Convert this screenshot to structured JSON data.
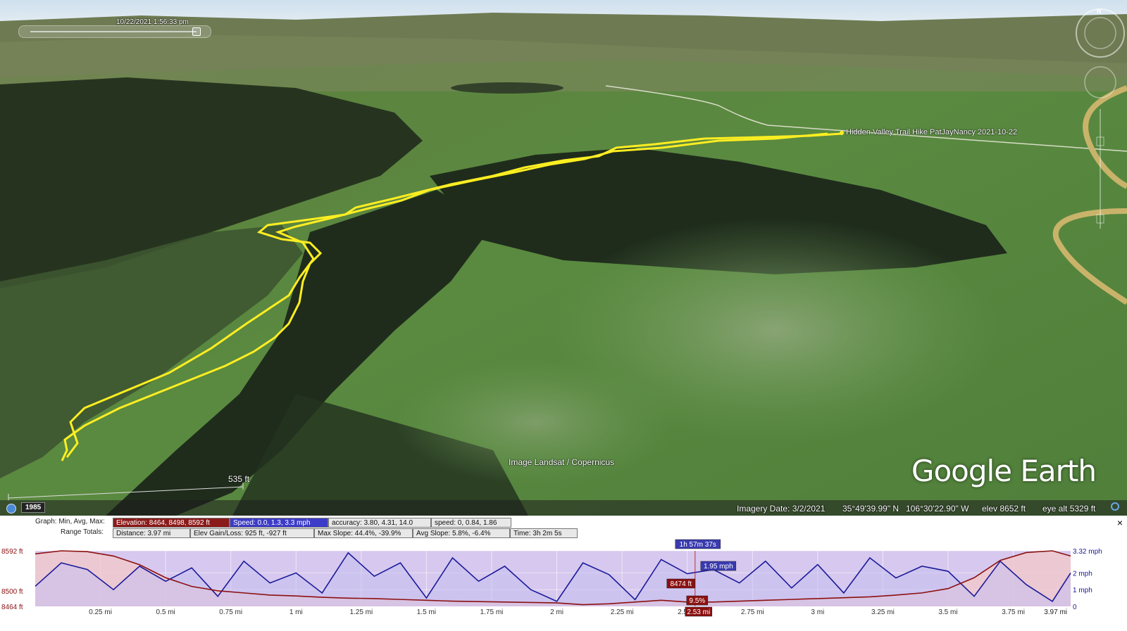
{
  "viewport": {
    "timestamp": "10/22/2021   1:56:33 pm",
    "placemark_label": "Hidden Valley Trail Hike PatJayNancy 2021-10-22",
    "image_credit": "Image Landsat / Copernicus",
    "scale_label": "535 ft",
    "logo": "Google Earth",
    "compass_label": "N",
    "track_color": "#ffee22"
  },
  "status_bar": {
    "year": "1985",
    "imagery_date": "Imagery Date: 3/2/2021",
    "latitude": "35°49'39.99\" N",
    "longitude": "106°30'22.90\" W",
    "elevation": "elev  8652 ft",
    "eye_alt": "eye alt    5329 ft"
  },
  "profile": {
    "graph_label": "Graph: Min, Avg, Max:",
    "range_label": "Range Totals:",
    "graph_stats": [
      {
        "text": "Elevation: 8464, 8498, 8592 ft",
        "kind": "elev"
      },
      {
        "text": "Speed: 0.0, 1.3, 3.3 mph",
        "kind": "speed"
      },
      {
        "text": "accuracy: 3.80, 4.31, 14.0",
        "kind": "plain"
      },
      {
        "text": "speed: 0, 0.84, 1.86",
        "kind": "plain"
      }
    ],
    "range_totals": [
      "Distance: 3.97 mi",
      "Elev Gain/Loss: 925 ft, -927 ft",
      "Max Slope: 44.4%, -39.9%",
      "Avg Slope: 5.8%, -6.4%",
      "Time: 3h 2m 5s"
    ],
    "close": "×"
  },
  "chart_data": {
    "type": "line",
    "x": [
      0,
      0.1,
      0.2,
      0.3,
      0.4,
      0.5,
      0.6,
      0.7,
      0.8,
      0.9,
      1,
      1.1,
      1.2,
      1.3,
      1.4,
      1.5,
      1.6,
      1.7,
      1.8,
      1.9,
      2,
      2.1,
      2.2,
      2.3,
      2.4,
      2.5,
      2.6,
      2.7,
      2.8,
      2.9,
      3,
      3.1,
      3.2,
      3.3,
      3.4,
      3.5,
      3.6,
      3.7,
      3.8,
      3.9,
      3.97
    ],
    "series": [
      {
        "name": "Elevation",
        "axis": "left",
        "color": "#8b1010",
        "values": [
          8585,
          8592,
          8590,
          8580,
          8560,
          8530,
          8510,
          8500,
          8495,
          8490,
          8488,
          8485,
          8483,
          8482,
          8480,
          8478,
          8476,
          8475,
          8474,
          8473,
          8472,
          8468,
          8470,
          8474,
          8478,
          8474,
          8474,
          8476,
          8478,
          8480,
          8482,
          8484,
          8486,
          8490,
          8495,
          8505,
          8530,
          8570,
          8588,
          8592,
          8580
        ]
      },
      {
        "name": "Speed",
        "axis": "right",
        "color": "#1a1a9a",
        "values": [
          1.2,
          2.6,
          2.2,
          1.0,
          2.4,
          1.5,
          2.3,
          0.6,
          2.7,
          1.4,
          2.0,
          0.8,
          3.2,
          1.8,
          2.6,
          0.5,
          2.9,
          1.5,
          2.4,
          1.0,
          0.3,
          2.6,
          1.9,
          0.4,
          2.8,
          1.95,
          2.2,
          1.4,
          2.7,
          1.1,
          2.5,
          0.8,
          2.9,
          1.7,
          2.4,
          2.1,
          0.6,
          2.7,
          1.3,
          0.3,
          2.0
        ]
      }
    ],
    "x_tick_labels": [
      "0.25 mi",
      "0.5 mi",
      "0.75 mi",
      "1 mi",
      "1.25 mi",
      "1.5 mi",
      "1.75 mi",
      "2 mi",
      "2.25 mi",
      "2.5 mi",
      "2.75 mi",
      "3 mi",
      "3.25 mi",
      "3.5 mi",
      "3.75 mi"
    ],
    "x_tick_values": [
      0.25,
      0.5,
      0.75,
      1,
      1.25,
      1.5,
      1.75,
      2,
      2.25,
      2.5,
      2.75,
      3,
      3.25,
      3.5,
      3.75
    ],
    "x_end_label": "3.97 mi",
    "y_left_labels": [
      "8592 ft",
      "8500 ft",
      "8464 ft"
    ],
    "y_left_values": [
      8592,
      8500,
      8464
    ],
    "y_right_labels": [
      "3.32 mph",
      "2 mph",
      "1 mph",
      "0"
    ],
    "y_right_values": [
      3.32,
      2,
      1,
      0
    ],
    "ylim_left": [
      8464,
      8592
    ],
    "ylim_right": [
      0,
      3.32
    ],
    "xlim": [
      0,
      3.97
    ],
    "cursor": {
      "x": 2.53,
      "time": "1h 57m 37s",
      "speed": "1.95 mph",
      "elevation": "8474 ft",
      "slope": "9.5%",
      "distance": "2.53 mi"
    }
  }
}
